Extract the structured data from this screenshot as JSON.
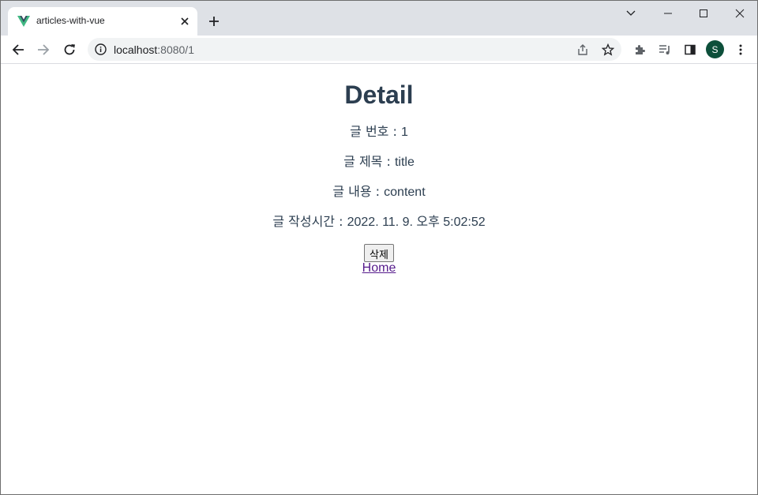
{
  "browser": {
    "tab_title": "articles-with-vue",
    "url_host": "localhost",
    "url_path": ":8080/1",
    "profile_initial": "S",
    "accent_color": "#0d4f3a"
  },
  "icons": {
    "favicon": "vue-logo-icon",
    "tab_close": "close-icon",
    "new_tab": "plus-icon",
    "back": "arrow-left-icon",
    "forward": "arrow-right-icon",
    "reload": "reload-icon",
    "site_info": "info-icon",
    "share": "share-icon",
    "bookmark": "star-icon",
    "extensions": "puzzle-icon",
    "media": "playlist-icon",
    "side_panel": "side-panel-icon",
    "menu": "kebab-menu-icon"
  },
  "page": {
    "title": "Detail",
    "fields": [
      {
        "label": "글 번호 : ",
        "value": "1"
      },
      {
        "label": "글 제목 : ",
        "value": "title"
      },
      {
        "label": "글 내용 : ",
        "value": "content"
      },
      {
        "label": "글 작성시간 : ",
        "value": "2022. 11. 9. 오후 5:02:52"
      }
    ],
    "delete_label": "삭제",
    "home_label": "Home"
  }
}
